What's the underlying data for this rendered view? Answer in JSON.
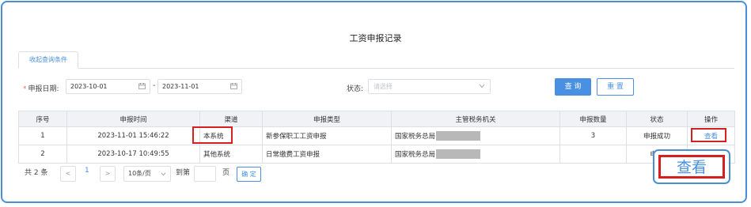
{
  "page_title": "工资申报记录",
  "tab_label": "收起查询条件",
  "filters": {
    "date_label": "申报日期:",
    "date_start": "2023-10-01",
    "date_separator": "-",
    "date_end": "2023-11-01",
    "status_label": "状态:",
    "status_placeholder": "请选择",
    "query_label": "查 询",
    "reset_label": "重 置"
  },
  "table": {
    "headers": [
      "序号",
      "申报时间",
      "渠道",
      "申报类型",
      "主管税务机关",
      "申报数量",
      "状态",
      "操作"
    ],
    "rows": [
      {
        "index": "1",
        "time": "2023-11-01 15:46:22",
        "channel": "本系统",
        "type": "新参保职工工资申报",
        "authority": "国家税务总局",
        "count": "3",
        "status": "申报成功",
        "action": "查看"
      },
      {
        "index": "2",
        "time": "2023-10-17 10:49:55",
        "channel": "其他系统",
        "type": "日常缴费工资申报",
        "authority": "国家税务总局",
        "count": "",
        "status": "申报",
        "action": ""
      }
    ]
  },
  "pagination": {
    "total_prefix": "共",
    "total": "2",
    "total_suffix": "条",
    "prev": "<",
    "current_page": "1",
    "next": ">",
    "page_size": "10条/页",
    "goto_label": "到第",
    "goto_value": "",
    "page_unit": "页",
    "confirm_label": "确 定"
  },
  "callout_label": "查看",
  "colors": {
    "accent": "#4a90e2",
    "highlight": "#d62020",
    "success": "#4cae4c"
  }
}
